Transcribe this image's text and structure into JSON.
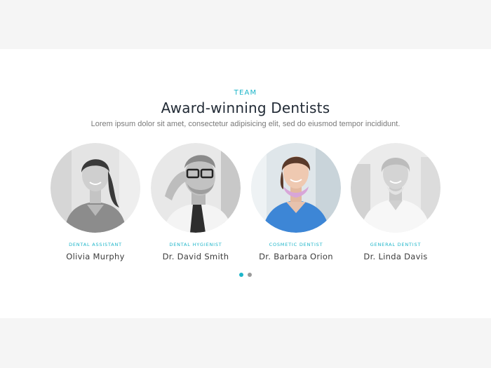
{
  "section": {
    "eyebrow": "TEAM",
    "title": "Award-winning Dentists",
    "subtitle": "Lorem ipsum dolor sit amet, consectetur adipisicing elit, sed do eiusmod tempor incididunt."
  },
  "team": [
    {
      "role": "Dental Assistant",
      "name": "Olivia Murphy"
    },
    {
      "role": "Dental Hygienist",
      "name": "Dr. David Smith"
    },
    {
      "role": "Cosmetic Dentist",
      "name": "Dr. Barbara Orion"
    },
    {
      "role": "General Dentist",
      "name": "Dr. Linda Davis"
    }
  ],
  "carousel": {
    "pages": 2,
    "active_page": 1
  },
  "colors": {
    "accent": "#1cb5c9",
    "page_bg": "#f5f5f5",
    "card_bg": "#ffffff",
    "title": "#222b36",
    "subtitle": "#7a7a7a",
    "name": "#3c3c3c",
    "inactive_dot": "#9a9a9a"
  }
}
